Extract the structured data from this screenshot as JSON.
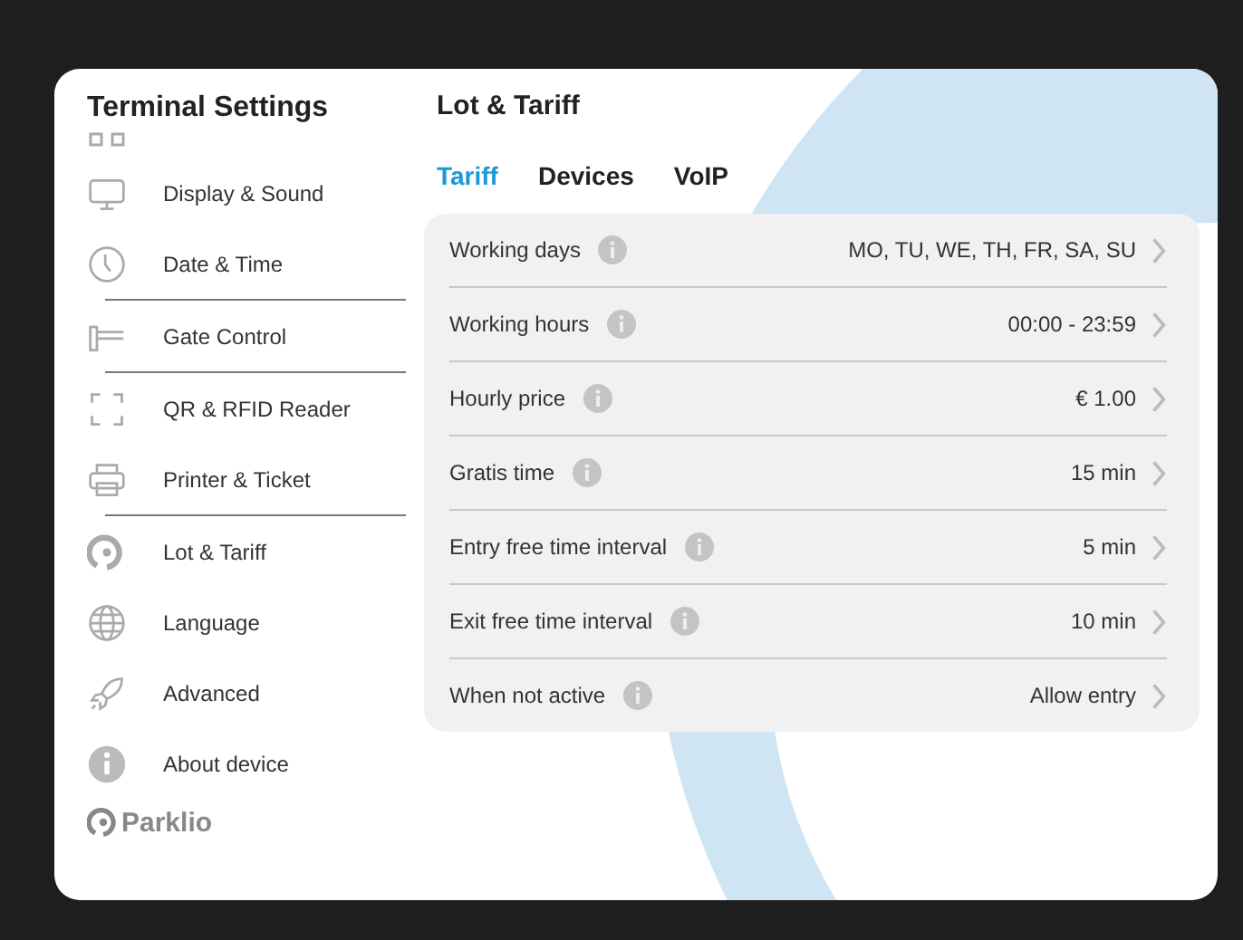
{
  "sidebar": {
    "title": "Terminal Settings",
    "groups": [
      {
        "items": [
          {
            "kind": "clipped"
          },
          {
            "kind": "item",
            "label": "Display & Sound"
          },
          {
            "kind": "item",
            "label": "Date & Time"
          }
        ]
      },
      {
        "items": [
          {
            "kind": "item",
            "label": "Gate Control"
          }
        ]
      },
      {
        "items": [
          {
            "kind": "item",
            "label": "QR & RFID Reader"
          },
          {
            "kind": "item",
            "label": "Printer & Ticket"
          }
        ]
      },
      {
        "items": [
          {
            "kind": "item",
            "label": "Lot & Tariff"
          },
          {
            "kind": "item",
            "label": "Language"
          },
          {
            "kind": "item",
            "label": "Advanced"
          },
          {
            "kind": "item",
            "label": "About device"
          }
        ]
      }
    ],
    "logo": "Parklio"
  },
  "page": {
    "title": "Lot & Tariff",
    "tabs": [
      {
        "label": "Tariff",
        "selected": true
      },
      {
        "label": "Devices",
        "selected": false
      },
      {
        "label": "VoIP",
        "selected": false
      }
    ],
    "settings": [
      {
        "label": "Working days",
        "value": "MO, TU, WE, TH, FR, SA, SU"
      },
      {
        "label": "Working hours",
        "value": "00:00 - 23:59"
      },
      {
        "label": "Hourly price",
        "value": "€ 1.00"
      },
      {
        "label": "Gratis time",
        "value": "15 min"
      },
      {
        "label": "Entry free time interval",
        "value": "5 min"
      },
      {
        "label": "Exit free time interval",
        "value": "10 min"
      },
      {
        "label": "When not active",
        "value": "Allow entry"
      }
    ]
  }
}
